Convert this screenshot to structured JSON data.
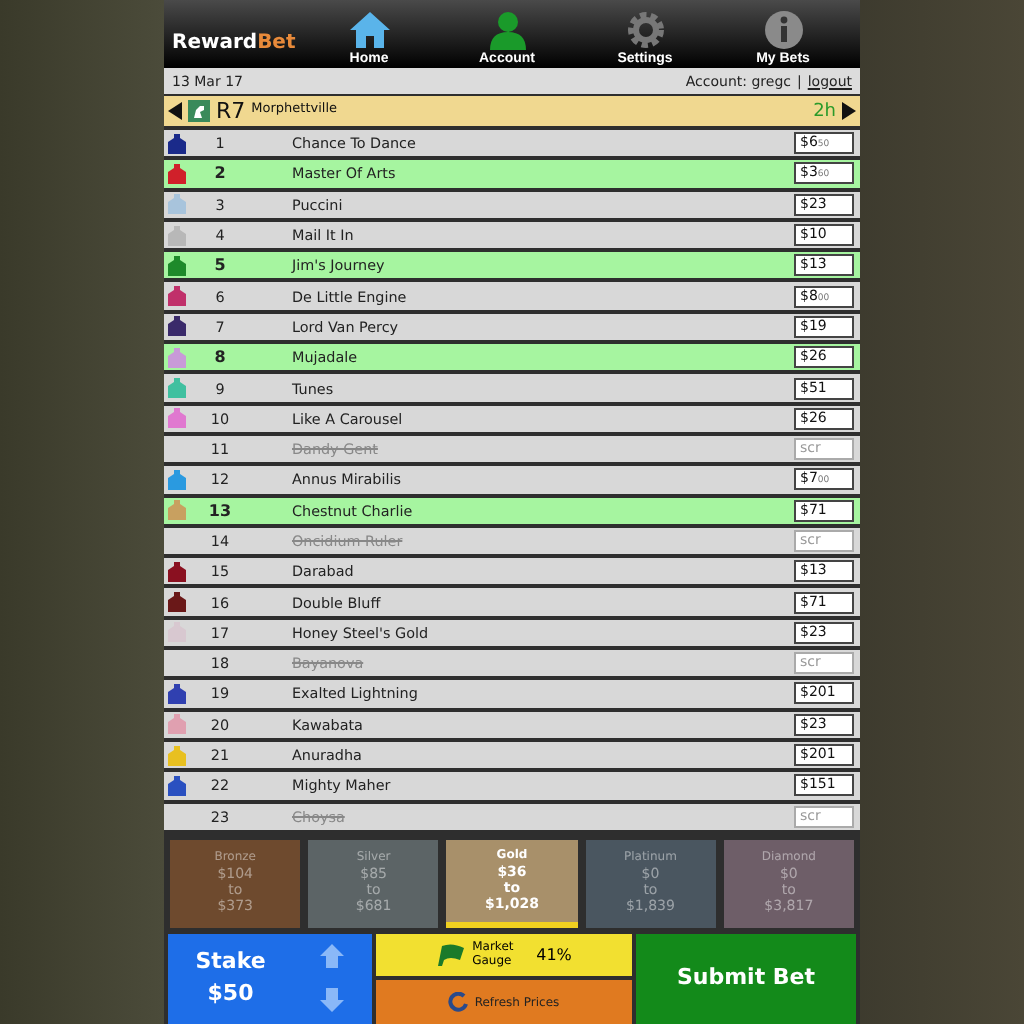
{
  "brand": {
    "name": "Reward",
    "accent": "Bet"
  },
  "nav": [
    {
      "label": "Home",
      "kind": "home"
    },
    {
      "label": "Account",
      "kind": "account"
    },
    {
      "label": "Settings",
      "kind": "settings"
    },
    {
      "label": "My Bets",
      "kind": "info"
    }
  ],
  "info_bar": {
    "date": "13 Mar 17",
    "account": "Account: gregc",
    "separator": "|",
    "logout": "logout"
  },
  "race": {
    "number": "R7",
    "venue": "Morphettville",
    "time": "2h"
  },
  "runners": [
    {
      "number": "1",
      "name": "Chance To Dance",
      "price": "$6",
      "cents": "50",
      "selected": false,
      "scratched": false,
      "color": "#1a2a8a"
    },
    {
      "number": "2",
      "name": "Master Of Arts",
      "price": "$3",
      "cents": "60",
      "selected": true,
      "scratched": false,
      "color": "#d0202a"
    },
    {
      "number": "3",
      "name": "Puccini",
      "price": "$23",
      "selected": false,
      "scratched": false,
      "color": "#a8c4dc"
    },
    {
      "number": "4",
      "name": "Mail It In",
      "price": "$10",
      "selected": false,
      "scratched": false,
      "color": "#b8b8b8"
    },
    {
      "number": "5",
      "name": "Jim's Journey",
      "price": "$13",
      "selected": true,
      "scratched": false,
      "color": "#1e8a2a"
    },
    {
      "number": "6",
      "name": "De Little Engine",
      "price": "$8",
      "cents": "00",
      "selected": false,
      "scratched": false,
      "color": "#c0306a"
    },
    {
      "number": "7",
      "name": "Lord Van Percy",
      "price": "$19",
      "selected": false,
      "scratched": false,
      "color": "#3a2a6a"
    },
    {
      "number": "8",
      "name": "Mujadale",
      "price": "$26",
      "selected": true,
      "scratched": false,
      "color": "#c89ad8"
    },
    {
      "number": "9",
      "name": "Tunes",
      "price": "$51",
      "selected": false,
      "scratched": false,
      "color": "#40c0a0"
    },
    {
      "number": "10",
      "name": "Like A Carousel",
      "price": "$26",
      "selected": false,
      "scratched": false,
      "color": "#e078d0"
    },
    {
      "number": "11",
      "name": "Dandy Gent",
      "price": "scr",
      "selected": false,
      "scratched": true
    },
    {
      "number": "12",
      "name": "Annus Mirabilis",
      "price": "$7",
      "cents": "00",
      "selected": false,
      "scratched": false,
      "color": "#2a9ae0"
    },
    {
      "number": "13",
      "name": "Chestnut Charlie",
      "price": "$71",
      "selected": true,
      "scratched": false,
      "color": "#c8a060"
    },
    {
      "number": "14",
      "name": "Oncidium Ruler",
      "price": "scr",
      "selected": false,
      "scratched": true
    },
    {
      "number": "15",
      "name": "Darabad",
      "price": "$13",
      "selected": false,
      "scratched": false,
      "color": "#8a1020"
    },
    {
      "number": "16",
      "name": "Double Bluff",
      "price": "$71",
      "selected": false,
      "scratched": false,
      "color": "#6a1818"
    },
    {
      "number": "17",
      "name": "Honey Steel's Gold",
      "price": "$23",
      "selected": false,
      "scratched": false,
      "color": "#d8c8d0"
    },
    {
      "number": "18",
      "name": "Bayanova",
      "price": "scr",
      "selected": false,
      "scratched": true
    },
    {
      "number": "19",
      "name": "Exalted Lightning",
      "price": "$201",
      "selected": false,
      "scratched": false,
      "color": "#3040b0"
    },
    {
      "number": "20",
      "name": "Kawabata",
      "price": "$23",
      "selected": false,
      "scratched": false,
      "color": "#e0a0b0"
    },
    {
      "number": "21",
      "name": "Anuradha",
      "price": "$201",
      "selected": false,
      "scratched": false,
      "color": "#e8c020"
    },
    {
      "number": "22",
      "name": "Mighty Maher",
      "price": "$151",
      "selected": false,
      "scratched": false,
      "color": "#2a50c0"
    },
    {
      "number": "23",
      "name": "Choysa",
      "price": "scr",
      "selected": false,
      "scratched": true
    }
  ],
  "tiers": [
    {
      "name": "Bronze",
      "from": "$104",
      "to_word": "to",
      "to": "$373",
      "selected": false,
      "color": "#6e4a2e"
    },
    {
      "name": "Silver",
      "from": "$85",
      "to_word": "to",
      "to": "$681",
      "selected": false,
      "color": "#5c6466"
    },
    {
      "name": "Gold",
      "from": "$36",
      "to_word": "to",
      "to": "$1,028",
      "selected": true,
      "color": "#a8906a"
    },
    {
      "name": "Platinum",
      "from": "$0",
      "to_word": "to",
      "to": "$1,839",
      "selected": false,
      "color": "#4a5660"
    },
    {
      "name": "Diamond",
      "from": "$0",
      "to_word": "to",
      "to": "$3,817",
      "selected": false,
      "color": "#6e5e68"
    }
  ],
  "stake": {
    "label": "Stake",
    "amount": "$50"
  },
  "gauge": {
    "label": "Market Gauge",
    "percent": "41%"
  },
  "refresh": {
    "label": "Refresh Prices"
  },
  "submit": {
    "label": "Submit Bet"
  }
}
